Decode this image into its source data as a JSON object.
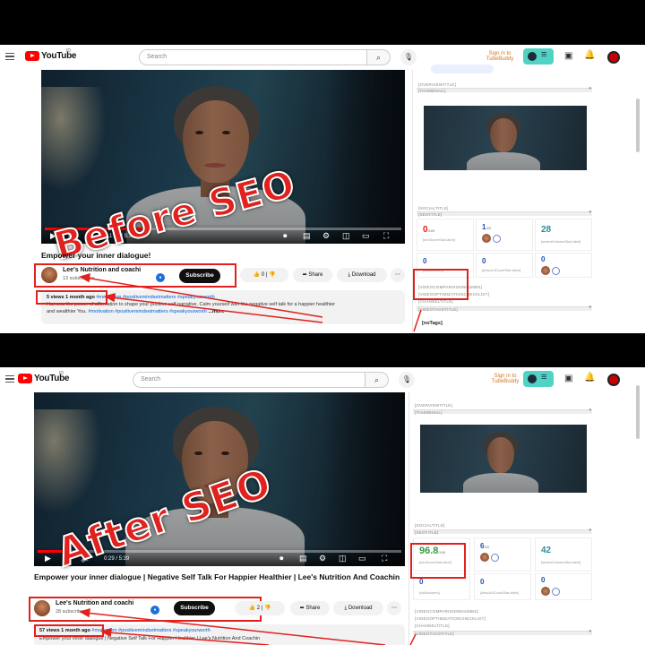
{
  "colors": {
    "accent_red": "#e0211d",
    "subscribe_bg": "#0f0f0f",
    "tubebuddy_teal": "#4fd3c5",
    "link_blue": "#065fd4"
  },
  "header": {
    "logo": "YouTube",
    "country_code": "ID",
    "search_placeholder": "Search",
    "search_icon": "search-icon",
    "mic_icon": "mic-icon",
    "signin": "Sign in to",
    "signin_brand": "TubeBuddy",
    "icons": [
      "create-icon",
      "bell-icon",
      "avatar"
    ]
  },
  "before": {
    "overlay": "Before SEO",
    "progress": 0.28,
    "time": "1:52 / 5:39",
    "title": "Empower your inner dialogue!",
    "channel": "Lee's Nutrition and coachi",
    "subscribers": "13 subscribers",
    "subscribe": "Subscribe",
    "likes": "0",
    "share": "Share",
    "download": "Download",
    "views": "5 views",
    "ago": "1 month ago",
    "desc_line1_tags": "#motivation #positivemindsetmatters #speakyourworth",
    "desc_line2": "Harness the power of affirmation to shape your positive self narrative. Calm yourself with the negative self talk for a happier healthier",
    "desc_line3": "and wealthier You.",
    "desc_line3_tags": "#motivation #positivemindsetmatters #speakyourworth",
    "more": "...more",
    "side": {
      "labels": [
        "[OVERVIEWTITLE]",
        "[THUMBNAIL]",
        "[SOCIALTITLE]",
        "[SEOTITLE]",
        "[VIDEOCOMPARISONNHUMBS]",
        "[VIDEOOPTIMIZATIONCHECKLIST]",
        "[CHANNELTITLE]",
        "[VIDEOTAGSTITLE]"
      ],
      "seo_score": "0",
      "seo_max": "/100",
      "seo_sub": "[seoScoreStat.label]",
      "rank": "1",
      "rank_max": "/20",
      "views_count": "28",
      "views_sub": "[searchVolumeStat.label]",
      "a": "0",
      "a_sub": "[vidAnswers]",
      "b": "0",
      "b_sub": "[descUrlCountStat.label]",
      "c": "0",
      "tags": "[noTags]"
    }
  },
  "after": {
    "overlay": "After SEO",
    "progress": 0.08,
    "time": "0:29 / 5:39",
    "title": "Empower your inner dialogue | Negative Self Talk For Happier Healthier | Lee's Nutrition And Coachin",
    "channel": "Lee's Nutrition and coachi",
    "subscribers": "28 subscribers",
    "subscribe": "Subscribe",
    "likes": "2",
    "share": "Share",
    "download": "Download",
    "views": "57 views",
    "ago": "1 month ago",
    "desc_line1_tags": "#motivation #positivemindsetmatters #speakyourworth",
    "desc_line2": "Empower your inner dialogue | Negative Self Talk For Happier Healthier | Lee's Nutrition And Coachin",
    "side": {
      "labels": [
        "[OVERVIEWTITLE]",
        "[THUMBNAIL]",
        "[SOCIALTITLE]",
        "[SEOTITLE]",
        "[VIDEOCOMPARISONNHUMBS]",
        "[VIDEOOPTIMIZATIONCHECKLIST]",
        "[CHANNELTITLE]",
        "[VIDEOTAGSTITLE]"
      ],
      "seo_score": "96.8",
      "seo_max": "/100",
      "seo_sub": "[seoScoreStat.label]",
      "rank": "6",
      "rank_max": "/20",
      "views_count": "42",
      "views_sub": "[searchVolumeStat.label]",
      "a": "0",
      "a_sub": "[vidAnswers]",
      "b": "0",
      "b_sub": "[descUrlCountStat.label]",
      "c": "0"
    }
  }
}
